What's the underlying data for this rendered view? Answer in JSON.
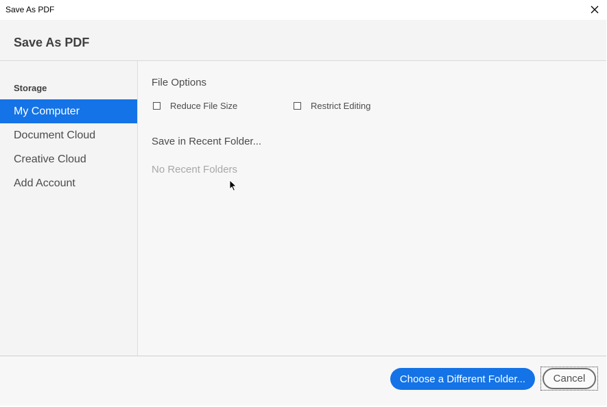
{
  "window": {
    "title": "Save As PDF",
    "close_icon": "close-icon"
  },
  "header": {
    "heading": "Save As PDF"
  },
  "sidebar": {
    "section_label": "Storage",
    "items": [
      {
        "label": "My Computer",
        "selected": true
      },
      {
        "label": "Document Cloud",
        "selected": false
      },
      {
        "label": "Creative Cloud",
        "selected": false
      },
      {
        "label": "Add Account",
        "selected": false
      }
    ]
  },
  "main": {
    "file_options_label": "File Options",
    "options": [
      {
        "label": "Reduce File Size",
        "checked": false
      },
      {
        "label": "Restrict Editing",
        "checked": false
      }
    ],
    "recent_folder_label": "Save in Recent Folder...",
    "recent_empty_text": "No Recent Folders"
  },
  "footer": {
    "choose_folder_label": "Choose a Different Folder...",
    "cancel_label": "Cancel"
  },
  "colors": {
    "accent": "#1473e6",
    "muted_text": "#a8a8a8"
  }
}
